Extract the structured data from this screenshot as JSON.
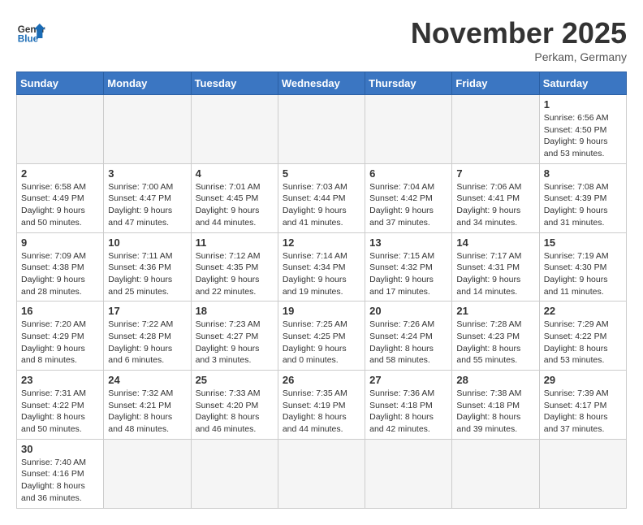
{
  "header": {
    "logo_general": "General",
    "logo_blue": "Blue",
    "month_title": "November 2025",
    "subtitle": "Perkam, Germany"
  },
  "weekdays": [
    "Sunday",
    "Monday",
    "Tuesday",
    "Wednesday",
    "Thursday",
    "Friday",
    "Saturday"
  ],
  "days": [
    {
      "date": "",
      "info": ""
    },
    {
      "date": "",
      "info": ""
    },
    {
      "date": "",
      "info": ""
    },
    {
      "date": "",
      "info": ""
    },
    {
      "date": "",
      "info": ""
    },
    {
      "date": "",
      "info": ""
    },
    {
      "date": "1",
      "info": "Sunrise: 6:56 AM\nSunset: 4:50 PM\nDaylight: 9 hours and 53 minutes."
    },
    {
      "date": "2",
      "info": "Sunrise: 6:58 AM\nSunset: 4:49 PM\nDaylight: 9 hours and 50 minutes."
    },
    {
      "date": "3",
      "info": "Sunrise: 7:00 AM\nSunset: 4:47 PM\nDaylight: 9 hours and 47 minutes."
    },
    {
      "date": "4",
      "info": "Sunrise: 7:01 AM\nSunset: 4:45 PM\nDaylight: 9 hours and 44 minutes."
    },
    {
      "date": "5",
      "info": "Sunrise: 7:03 AM\nSunset: 4:44 PM\nDaylight: 9 hours and 41 minutes."
    },
    {
      "date": "6",
      "info": "Sunrise: 7:04 AM\nSunset: 4:42 PM\nDaylight: 9 hours and 37 minutes."
    },
    {
      "date": "7",
      "info": "Sunrise: 7:06 AM\nSunset: 4:41 PM\nDaylight: 9 hours and 34 minutes."
    },
    {
      "date": "8",
      "info": "Sunrise: 7:08 AM\nSunset: 4:39 PM\nDaylight: 9 hours and 31 minutes."
    },
    {
      "date": "9",
      "info": "Sunrise: 7:09 AM\nSunset: 4:38 PM\nDaylight: 9 hours and 28 minutes."
    },
    {
      "date": "10",
      "info": "Sunrise: 7:11 AM\nSunset: 4:36 PM\nDaylight: 9 hours and 25 minutes."
    },
    {
      "date": "11",
      "info": "Sunrise: 7:12 AM\nSunset: 4:35 PM\nDaylight: 9 hours and 22 minutes."
    },
    {
      "date": "12",
      "info": "Sunrise: 7:14 AM\nSunset: 4:34 PM\nDaylight: 9 hours and 19 minutes."
    },
    {
      "date": "13",
      "info": "Sunrise: 7:15 AM\nSunset: 4:32 PM\nDaylight: 9 hours and 17 minutes."
    },
    {
      "date": "14",
      "info": "Sunrise: 7:17 AM\nSunset: 4:31 PM\nDaylight: 9 hours and 14 minutes."
    },
    {
      "date": "15",
      "info": "Sunrise: 7:19 AM\nSunset: 4:30 PM\nDaylight: 9 hours and 11 minutes."
    },
    {
      "date": "16",
      "info": "Sunrise: 7:20 AM\nSunset: 4:29 PM\nDaylight: 9 hours and 8 minutes."
    },
    {
      "date": "17",
      "info": "Sunrise: 7:22 AM\nSunset: 4:28 PM\nDaylight: 9 hours and 6 minutes."
    },
    {
      "date": "18",
      "info": "Sunrise: 7:23 AM\nSunset: 4:27 PM\nDaylight: 9 hours and 3 minutes."
    },
    {
      "date": "19",
      "info": "Sunrise: 7:25 AM\nSunset: 4:25 PM\nDaylight: 9 hours and 0 minutes."
    },
    {
      "date": "20",
      "info": "Sunrise: 7:26 AM\nSunset: 4:24 PM\nDaylight: 8 hours and 58 minutes."
    },
    {
      "date": "21",
      "info": "Sunrise: 7:28 AM\nSunset: 4:23 PM\nDaylight: 8 hours and 55 minutes."
    },
    {
      "date": "22",
      "info": "Sunrise: 7:29 AM\nSunset: 4:22 PM\nDaylight: 8 hours and 53 minutes."
    },
    {
      "date": "23",
      "info": "Sunrise: 7:31 AM\nSunset: 4:22 PM\nDaylight: 8 hours and 50 minutes."
    },
    {
      "date": "24",
      "info": "Sunrise: 7:32 AM\nSunset: 4:21 PM\nDaylight: 8 hours and 48 minutes."
    },
    {
      "date": "25",
      "info": "Sunrise: 7:33 AM\nSunset: 4:20 PM\nDaylight: 8 hours and 46 minutes."
    },
    {
      "date": "26",
      "info": "Sunrise: 7:35 AM\nSunset: 4:19 PM\nDaylight: 8 hours and 44 minutes."
    },
    {
      "date": "27",
      "info": "Sunrise: 7:36 AM\nSunset: 4:18 PM\nDaylight: 8 hours and 42 minutes."
    },
    {
      "date": "28",
      "info": "Sunrise: 7:38 AM\nSunset: 4:18 PM\nDaylight: 8 hours and 39 minutes."
    },
    {
      "date": "29",
      "info": "Sunrise: 7:39 AM\nSunset: 4:17 PM\nDaylight: 8 hours and 37 minutes."
    },
    {
      "date": "30",
      "info": "Sunrise: 7:40 AM\nSunset: 4:16 PM\nDaylight: 8 hours and 36 minutes."
    }
  ]
}
